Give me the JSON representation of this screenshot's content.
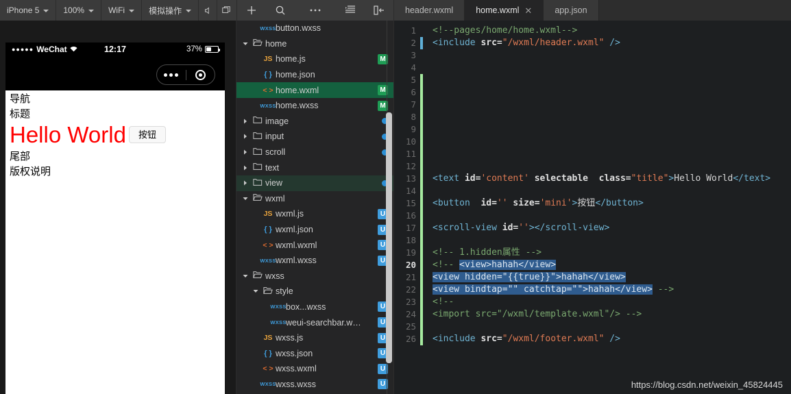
{
  "toolbar": {
    "device": "iPhone 5",
    "zoom": "100%",
    "network": "WiFi",
    "simulate": "模拟操作",
    "icons": {
      "volume": "volume-icon",
      "window": "window-icon",
      "add": "plus-icon",
      "search": "search-icon",
      "more": "more-icon",
      "outline": "outline-icon",
      "panel": "collapse-panel-icon"
    }
  },
  "tabs": [
    {
      "label": "header.wxml",
      "active": false,
      "closable": false
    },
    {
      "label": "home.wxml",
      "active": true,
      "closable": true,
      "close": "✕"
    },
    {
      "label": "app.json",
      "active": false,
      "closable": false
    }
  ],
  "simulator": {
    "status": {
      "signal": "●●●●●",
      "carrier": "WeChat",
      "wifi": "wifi-icon",
      "time": "12:17",
      "battery_pct": "37%"
    },
    "capsule": {
      "more": "more-dots-icon",
      "target": "target-icon"
    },
    "page": {
      "nav_line1": "导航",
      "nav_line2": "标题",
      "title": "Hello World",
      "title_color": "#ff0000",
      "button": "按钮",
      "footer_line1": "尾部",
      "footer_line2": "版权说明"
    }
  },
  "tree": [
    {
      "label": "button.wxss",
      "indent": 3,
      "arrow": "",
      "icon": "wxss",
      "badge": "",
      "dot": false,
      "state": ""
    },
    {
      "label": "home",
      "indent": 2,
      "arrow": "▼",
      "icon": "folder-open",
      "badge": "",
      "dot": false,
      "state": ""
    },
    {
      "label": "home.js",
      "indent": 3,
      "arrow": "",
      "icon": "js",
      "badge": "M",
      "dot": false,
      "state": ""
    },
    {
      "label": "home.json",
      "indent": 3,
      "arrow": "",
      "icon": "json",
      "badge": "",
      "dot": false,
      "state": ""
    },
    {
      "label": "home.wxml",
      "indent": 3,
      "arrow": "",
      "icon": "wxml",
      "badge": "M",
      "dot": false,
      "state": "sel"
    },
    {
      "label": "home.wxss",
      "indent": 3,
      "arrow": "",
      "icon": "wxss",
      "badge": "M",
      "dot": false,
      "state": ""
    },
    {
      "label": "image",
      "indent": 2,
      "arrow": "▶",
      "icon": "folder",
      "badge": "",
      "dot": true,
      "state": ""
    },
    {
      "label": "input",
      "indent": 2,
      "arrow": "▶",
      "icon": "folder",
      "badge": "",
      "dot": true,
      "state": ""
    },
    {
      "label": "scroll",
      "indent": 2,
      "arrow": "▶",
      "icon": "folder",
      "badge": "",
      "dot": true,
      "state": ""
    },
    {
      "label": "text",
      "indent": 2,
      "arrow": "▶",
      "icon": "folder",
      "badge": "",
      "dot": false,
      "state": ""
    },
    {
      "label": "view",
      "indent": 2,
      "arrow": "▶",
      "icon": "folder",
      "badge": "",
      "dot": true,
      "state": "hov"
    },
    {
      "label": "wxml",
      "indent": 2,
      "arrow": "▼",
      "icon": "folder-open",
      "badge": "",
      "dot": false,
      "state": ""
    },
    {
      "label": "wxml.js",
      "indent": 3,
      "arrow": "",
      "icon": "js",
      "badge": "U",
      "dot": false,
      "state": ""
    },
    {
      "label": "wxml.json",
      "indent": 3,
      "arrow": "",
      "icon": "json",
      "badge": "U",
      "dot": false,
      "state": ""
    },
    {
      "label": "wxml.wxml",
      "indent": 3,
      "arrow": "",
      "icon": "wxml",
      "badge": "U",
      "dot": false,
      "state": ""
    },
    {
      "label": "wxml.wxss",
      "indent": 3,
      "arrow": "",
      "icon": "wxss",
      "badge": "U",
      "dot": false,
      "state": ""
    },
    {
      "label": "wxss",
      "indent": 2,
      "arrow": "▼",
      "icon": "folder-open",
      "badge": "",
      "dot": false,
      "state": ""
    },
    {
      "label": "style",
      "indent": 3,
      "arrow": "▼",
      "icon": "folder-open",
      "badge": "",
      "dot": false,
      "state": ""
    },
    {
      "label": "box...wxss",
      "indent": 4,
      "arrow": "",
      "icon": "wxss",
      "badge": "U",
      "dot": false,
      "state": ""
    },
    {
      "label": "weui-searchbar.w…",
      "indent": 4,
      "arrow": "",
      "icon": "wxss",
      "badge": "U",
      "dot": false,
      "state": ""
    },
    {
      "label": "wxss.js",
      "indent": 3,
      "arrow": "",
      "icon": "js",
      "badge": "U",
      "dot": false,
      "state": ""
    },
    {
      "label": "wxss.json",
      "indent": 3,
      "arrow": "",
      "icon": "json",
      "badge": "U",
      "dot": false,
      "state": ""
    },
    {
      "label": "wxss.wxml",
      "indent": 3,
      "arrow": "",
      "icon": "wxml",
      "badge": "U",
      "dot": false,
      "state": ""
    },
    {
      "label": "wxss.wxss",
      "indent": 3,
      "arrow": "",
      "icon": "wxss",
      "badge": "U",
      "dot": false,
      "state": ""
    }
  ],
  "editor": {
    "line_count": 26,
    "cursor_line": 20,
    "gutter_marker_from": 5,
    "cursor_marker_line": 2,
    "lines": [
      {
        "n": 1,
        "parts": [
          {
            "t": "cm",
            "s": "<!--pages/home/home.wxml-->"
          }
        ]
      },
      {
        "n": 2,
        "parts": [
          {
            "t": "tg",
            "s": "<include "
          },
          {
            "t": "at",
            "s": "src="
          },
          {
            "t": "st",
            "s": "\"/wxml/header.wxml\""
          },
          {
            "t": "tg",
            "s": " />"
          }
        ]
      },
      {
        "n": 3,
        "parts": []
      },
      {
        "n": 4,
        "parts": []
      },
      {
        "n": 5,
        "parts": []
      },
      {
        "n": 6,
        "parts": []
      },
      {
        "n": 7,
        "parts": []
      },
      {
        "n": 8,
        "parts": []
      },
      {
        "n": 9,
        "parts": []
      },
      {
        "n": 10,
        "parts": []
      },
      {
        "n": 11,
        "parts": []
      },
      {
        "n": 12,
        "parts": []
      },
      {
        "n": 13,
        "parts": [
          {
            "t": "tg",
            "s": "<text "
          },
          {
            "t": "at",
            "s": "id="
          },
          {
            "t": "st",
            "s": "'content'"
          },
          {
            "t": "at",
            "s": " selectable"
          },
          {
            "t": "tx",
            "s": "  "
          },
          {
            "t": "at",
            "s": "class="
          },
          {
            "t": "st",
            "s": "\"title\""
          },
          {
            "t": "tg",
            "s": ">"
          },
          {
            "t": "tx",
            "s": "Hello World"
          },
          {
            "t": "tg",
            "s": "</text>"
          }
        ]
      },
      {
        "n": 14,
        "parts": []
      },
      {
        "n": 15,
        "parts": [
          {
            "t": "tg",
            "s": "<button "
          },
          {
            "t": "tx",
            "s": " "
          },
          {
            "t": "at",
            "s": "id="
          },
          {
            "t": "st",
            "s": "''"
          },
          {
            "t": "at",
            "s": " size="
          },
          {
            "t": "st",
            "s": "'mini'"
          },
          {
            "t": "tg",
            "s": ">"
          },
          {
            "t": "tx",
            "s": "按钮"
          },
          {
            "t": "tg",
            "s": "</button>"
          }
        ]
      },
      {
        "n": 16,
        "parts": []
      },
      {
        "n": 17,
        "parts": [
          {
            "t": "tg",
            "s": "<scroll-view "
          },
          {
            "t": "at",
            "s": "id="
          },
          {
            "t": "st",
            "s": "''"
          },
          {
            "t": "tg",
            "s": "></scroll-view>"
          }
        ]
      },
      {
        "n": 18,
        "parts": []
      },
      {
        "n": 19,
        "parts": [
          {
            "t": "cm",
            "s": "<!-- 1.hidden属性 -->"
          }
        ]
      },
      {
        "n": 20,
        "parts": [
          {
            "t": "cm",
            "s": "<!-- "
          },
          {
            "t": "sel",
            "s": "<view>hahah</view>"
          }
        ]
      },
      {
        "n": 21,
        "parts": [
          {
            "t": "sel",
            "s": "<view hidden=\"{{true}}\">hahah</view>"
          }
        ]
      },
      {
        "n": 22,
        "parts": [
          {
            "t": "sel",
            "s": "<view bindtap=\"\" catchtap=\"\">hahah</view>"
          },
          {
            "t": "cm",
            "s": " -->"
          }
        ]
      },
      {
        "n": 23,
        "parts": [
          {
            "t": "cm",
            "s": "<!--"
          }
        ]
      },
      {
        "n": 24,
        "parts": [
          {
            "t": "cm",
            "s": "<import src=\"/wxml/template.wxml\"/> -->"
          }
        ]
      },
      {
        "n": 25,
        "parts": []
      },
      {
        "n": 26,
        "parts": [
          {
            "t": "tg",
            "s": "<include "
          },
          {
            "t": "at",
            "s": "src="
          },
          {
            "t": "st",
            "s": "\"/wxml/footer.wxml\""
          },
          {
            "t": "tg",
            "s": " />"
          }
        ]
      }
    ]
  },
  "watermark": "https://blog.csdn.net/weixin_45824445"
}
